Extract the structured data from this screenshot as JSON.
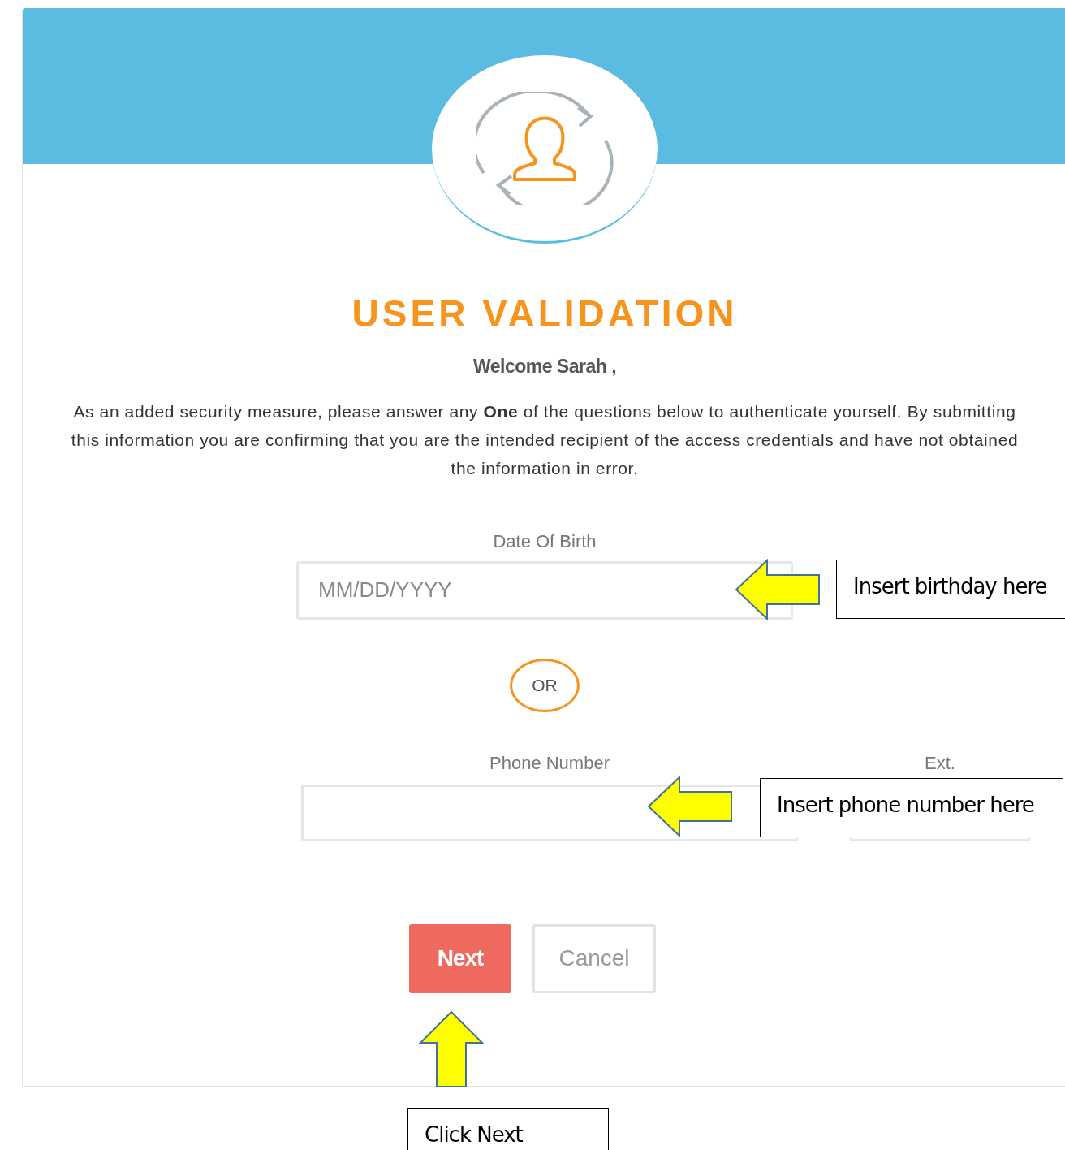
{
  "header": {
    "title": "USER VALIDATION",
    "greeting": "Welcome Sarah ,",
    "intro": "As an added security measure, please answer any **One** of the questions below to authenticate yourself. By submitting this information you are confirming that you are the intended recipient of the access credentials and have not obtained the information in error."
  },
  "form": {
    "date_of_birth": {
      "label": "Date Of Birth",
      "placeholder": "MM/DD/YYYY"
    },
    "divider": "OR",
    "phone": {
      "label": "Phone Number"
    },
    "extension": {
      "label": "Ext."
    }
  },
  "buttons": [
    {
      "label": "Next",
      "kind": "primary"
    },
    {
      "label": "Cancel",
      "kind": "secondary"
    }
  ],
  "annotations": [
    {
      "text": "Insert birthday here",
      "kind": "left"
    },
    {
      "text": "Insert phone number here",
      "kind": "left"
    },
    {
      "text": "Click Next",
      "kind": "up"
    }
  ]
}
